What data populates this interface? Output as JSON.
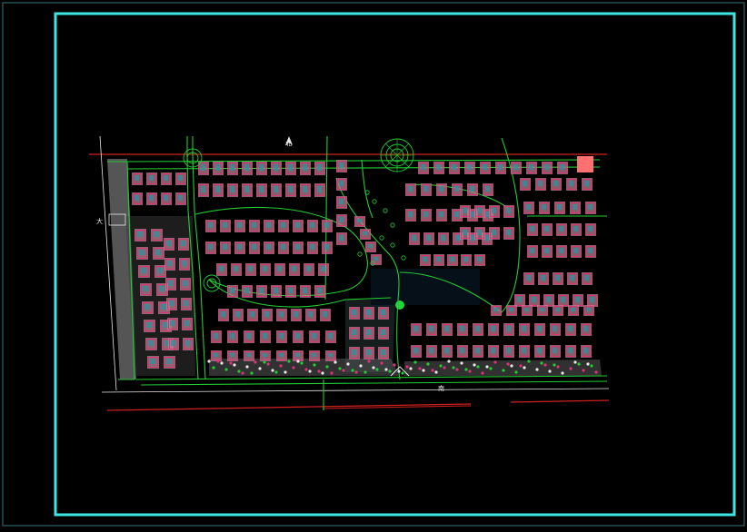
{
  "drawing": {
    "background": "#000000",
    "outer_frame_color": "#3a7a78",
    "title_frame_color": "#3ee6e6",
    "colors": {
      "road": "#22cc33",
      "building_outline": "#e0307a",
      "building_fill": "#2f8fa0",
      "lot_fill": "#b87e8c",
      "plaza": "#9a9a9a",
      "boundary": "#d02020",
      "accent": "#ff7070",
      "white_line": "#e8e8e8",
      "dark_water": "#061018"
    },
    "plan_labels": {
      "west_gate_tag": "大",
      "north_tag": "北",
      "south_tag": "南"
    },
    "north_arrow_icon": "north-arrow-icon",
    "feature_icons": [
      "roundabout-icon",
      "fountain-plaza-icon",
      "pond-icon",
      "tree-icon"
    ]
  }
}
